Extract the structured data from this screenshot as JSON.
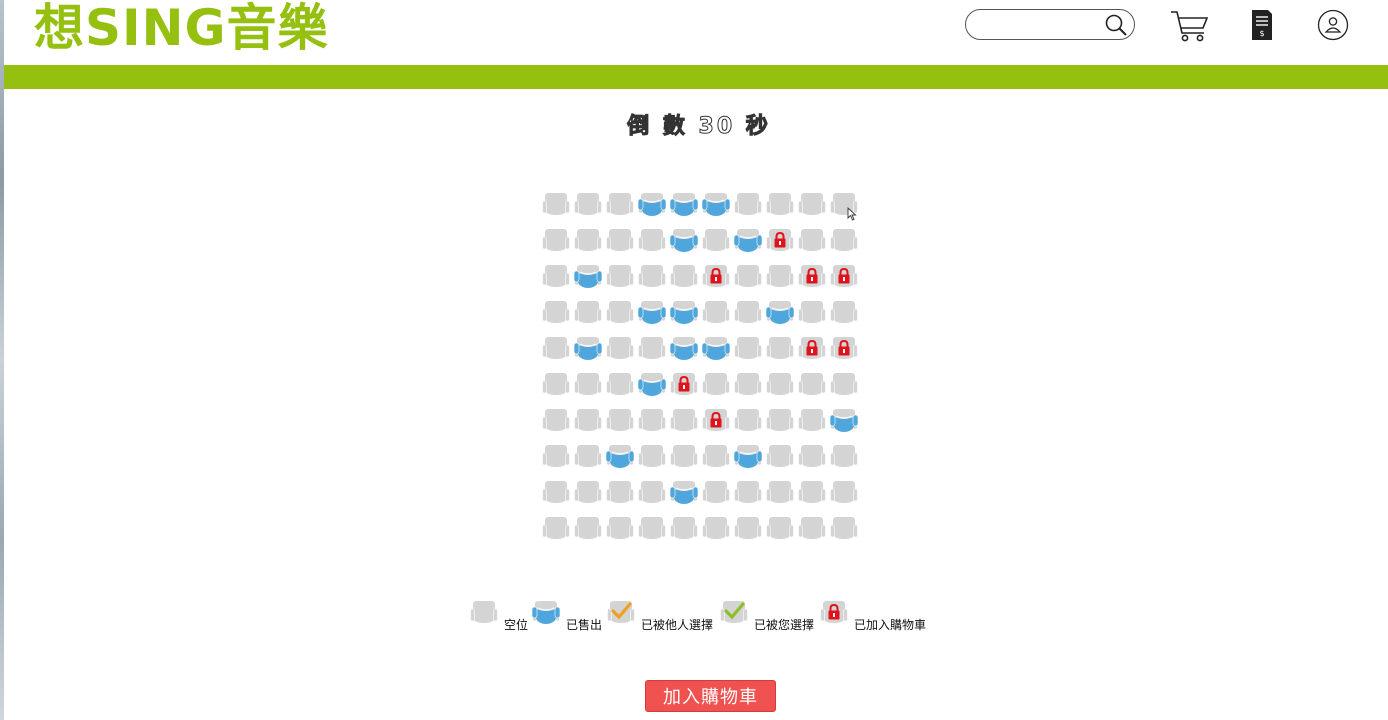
{
  "header": {
    "logo": "想SING音樂",
    "search_placeholder": ""
  },
  "countdown": "倒 數 30 秒",
  "seat_map": {
    "legend_states": [
      "empty",
      "sold",
      "others",
      "mine",
      "locked"
    ],
    "rows": [
      [
        "empty",
        "empty",
        "empty",
        "sold",
        "sold",
        "sold",
        "empty",
        "empty",
        "empty",
        "empty"
      ],
      [
        "empty",
        "empty",
        "empty",
        "empty",
        "sold",
        "empty",
        "sold",
        "locked",
        "empty",
        "empty"
      ],
      [
        "empty",
        "sold",
        "empty",
        "empty",
        "empty",
        "locked",
        "empty",
        "empty",
        "locked",
        "locked"
      ],
      [
        "empty",
        "empty",
        "empty",
        "sold",
        "sold",
        "empty",
        "empty",
        "sold",
        "empty",
        "empty"
      ],
      [
        "empty",
        "sold",
        "empty",
        "empty",
        "sold",
        "sold",
        "empty",
        "empty",
        "locked",
        "locked"
      ],
      [
        "empty",
        "empty",
        "empty",
        "sold",
        "locked",
        "empty",
        "empty",
        "empty",
        "empty",
        "empty"
      ],
      [
        "empty",
        "empty",
        "empty",
        "empty",
        "empty",
        "locked",
        "empty",
        "empty",
        "empty",
        "sold"
      ],
      [
        "empty",
        "empty",
        "sold",
        "empty",
        "empty",
        "empty",
        "sold",
        "empty",
        "empty",
        "empty"
      ],
      [
        "empty",
        "empty",
        "empty",
        "empty",
        "sold",
        "empty",
        "empty",
        "empty",
        "empty",
        "empty"
      ],
      [
        "empty",
        "empty",
        "empty",
        "empty",
        "empty",
        "empty",
        "empty",
        "empty",
        "empty",
        "empty"
      ]
    ]
  },
  "legend": [
    {
      "state": "empty",
      "label": "空位"
    },
    {
      "state": "sold",
      "label": "已售出"
    },
    {
      "state": "others",
      "label": "已被他人選擇"
    },
    {
      "state": "mine",
      "label": "已被您選擇"
    },
    {
      "state": "locked",
      "label": "已加入購物車"
    }
  ],
  "button": {
    "add_to_cart": "加入購物車"
  },
  "colors": {
    "brand_green": "#95c00f",
    "seat_gray": "#d4d4d4",
    "sold_blue": "#4fa6dd",
    "lock_red": "#e0121c",
    "check_orange": "#f0a020",
    "check_green": "#8cc028",
    "button_red": "#f0524f"
  }
}
